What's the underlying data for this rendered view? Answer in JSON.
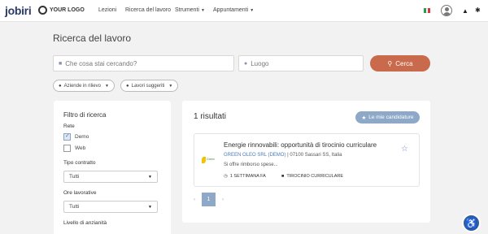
{
  "header": {
    "brand_main": "jobiri",
    "brand_secondary": "YOUR LOGO",
    "nav": [
      {
        "label": "Lezioni"
      },
      {
        "label": "Ricerca del lavoro"
      },
      {
        "label": "Strumenti"
      },
      {
        "label": "Appuntamenti"
      }
    ],
    "language_flag": "flag-italy-icon",
    "icons": [
      "user-avatar-icon",
      "bell-icon",
      "gear-icon"
    ]
  },
  "page": {
    "title": "Ricerca del lavoro"
  },
  "search": {
    "keyword_placeholder": "Che cosa stai cercando?",
    "location_placeholder": "Luogo",
    "button_label": "Cerca"
  },
  "chips": [
    {
      "label": "Aziende in rilievo"
    },
    {
      "label": "Lavori suggeriti"
    }
  ],
  "filters": {
    "title": "Filtro di ricerca",
    "rete_label": "Rete",
    "rete_options": [
      {
        "label": "Demo",
        "checked": true
      },
      {
        "label": "Web",
        "checked": false
      }
    ],
    "contract_label": "Tipo contratto",
    "contract_value": "Tutti",
    "hours_label": "Ore lavorative",
    "hours_value": "Tutti",
    "seniority_label": "Livello di anzianità"
  },
  "results": {
    "count_label": "1 risultati",
    "candidature_button": "Le mie candidature",
    "jobs": [
      {
        "title": "Energie rinnovabili: opportunità di tirocinio curriculare",
        "company": "GREEN OLEO SRL (DEMO)",
        "location": "| 07100 Sassari SS, Italia",
        "description": "Si offre rimborso spese...",
        "posted": "1 SETTIMANA FA",
        "contract": "TIROCINIO CURRICULARE",
        "logo_text": "Green"
      }
    ],
    "pagination": {
      "current": "1",
      "prev": "‹",
      "next": "›"
    }
  },
  "colors": {
    "accent": "#c96a4c",
    "secondary": "#8ea9c8",
    "link": "#4a7bb7",
    "background": "#f2f2f2"
  }
}
